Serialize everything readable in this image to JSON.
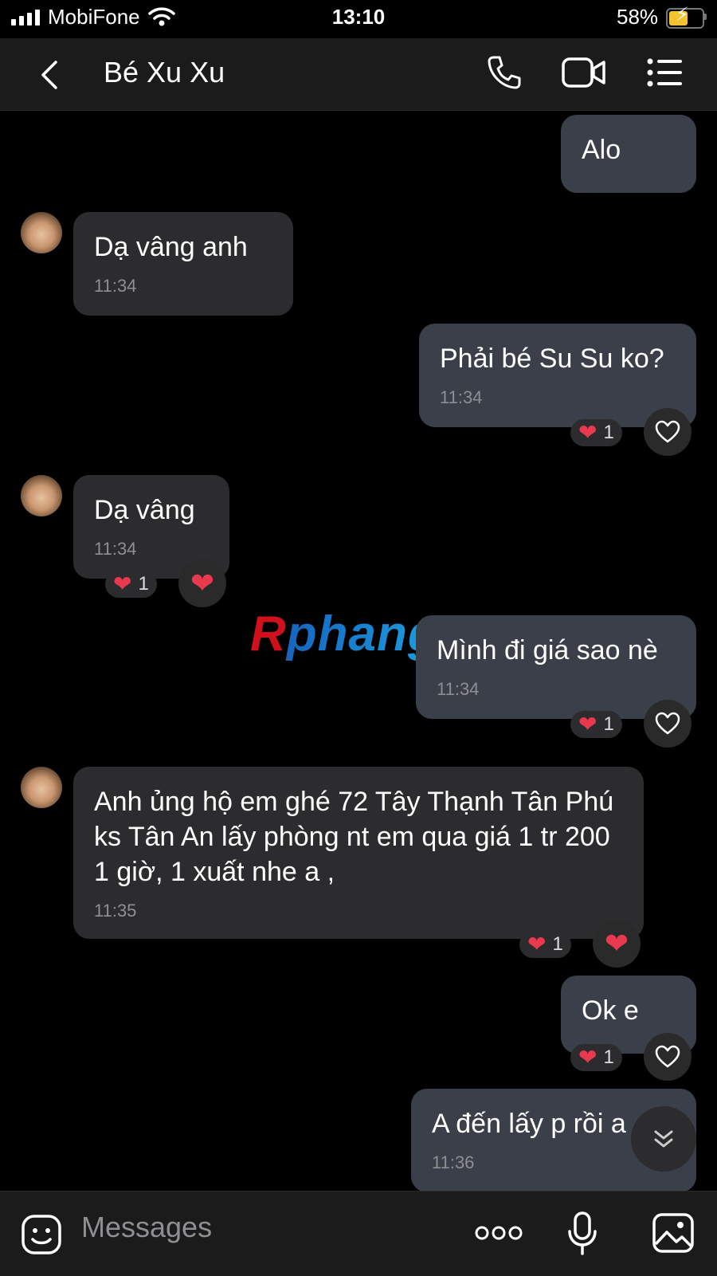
{
  "status_bar": {
    "carrier": "MobiFone",
    "time": "13:10",
    "battery_percent": "58%",
    "battery_level": 0.58,
    "charging": true
  },
  "header": {
    "title": "Bé Xu Xu",
    "icons": [
      "back-chevron-icon",
      "phone-icon",
      "video-camera-icon",
      "menu-list-icon"
    ]
  },
  "messages": [
    {
      "sender": "me",
      "text": "Alo",
      "time": ""
    },
    {
      "sender": "contact",
      "text": "Dạ vâng anh",
      "time": "11:34"
    },
    {
      "sender": "me",
      "text": "Phải bé Su Su ko?",
      "time": "11:34",
      "reaction_count": "1"
    },
    {
      "sender": "contact",
      "text": "Dạ vâng",
      "time": "11:34",
      "reaction_count": "1"
    },
    {
      "sender": "me",
      "text": "Mình đi giá sao nè",
      "time": "11:34",
      "reaction_count": "1"
    },
    {
      "sender": "contact",
      "text": "Anh ủng hộ em ghé 72 Tây Thạnh Tân Phú ks Tân An lấy phòng nt em qua giá 1 tr 200 1 giờ, 1 xuất nhe a ,",
      "time": "11:35",
      "reaction_count": "1"
    },
    {
      "sender": "me",
      "text": "Ok e",
      "time": "",
      "reaction_count": "1"
    },
    {
      "sender": "me",
      "text": "A đến lấy p rồi a",
      "time": "11:36"
    }
  ],
  "watermark": "Rphang",
  "composer": {
    "placeholder": "Messages",
    "icons": [
      "sticker-icon",
      "more-dots-icon",
      "microphone-icon",
      "image-icon"
    ]
  },
  "colors": {
    "background": "#000000",
    "bubble_contact": "#2c2c2e",
    "bubble_me": "#3a3f49",
    "heart": "#e8394f",
    "battery": "#f4c430"
  }
}
